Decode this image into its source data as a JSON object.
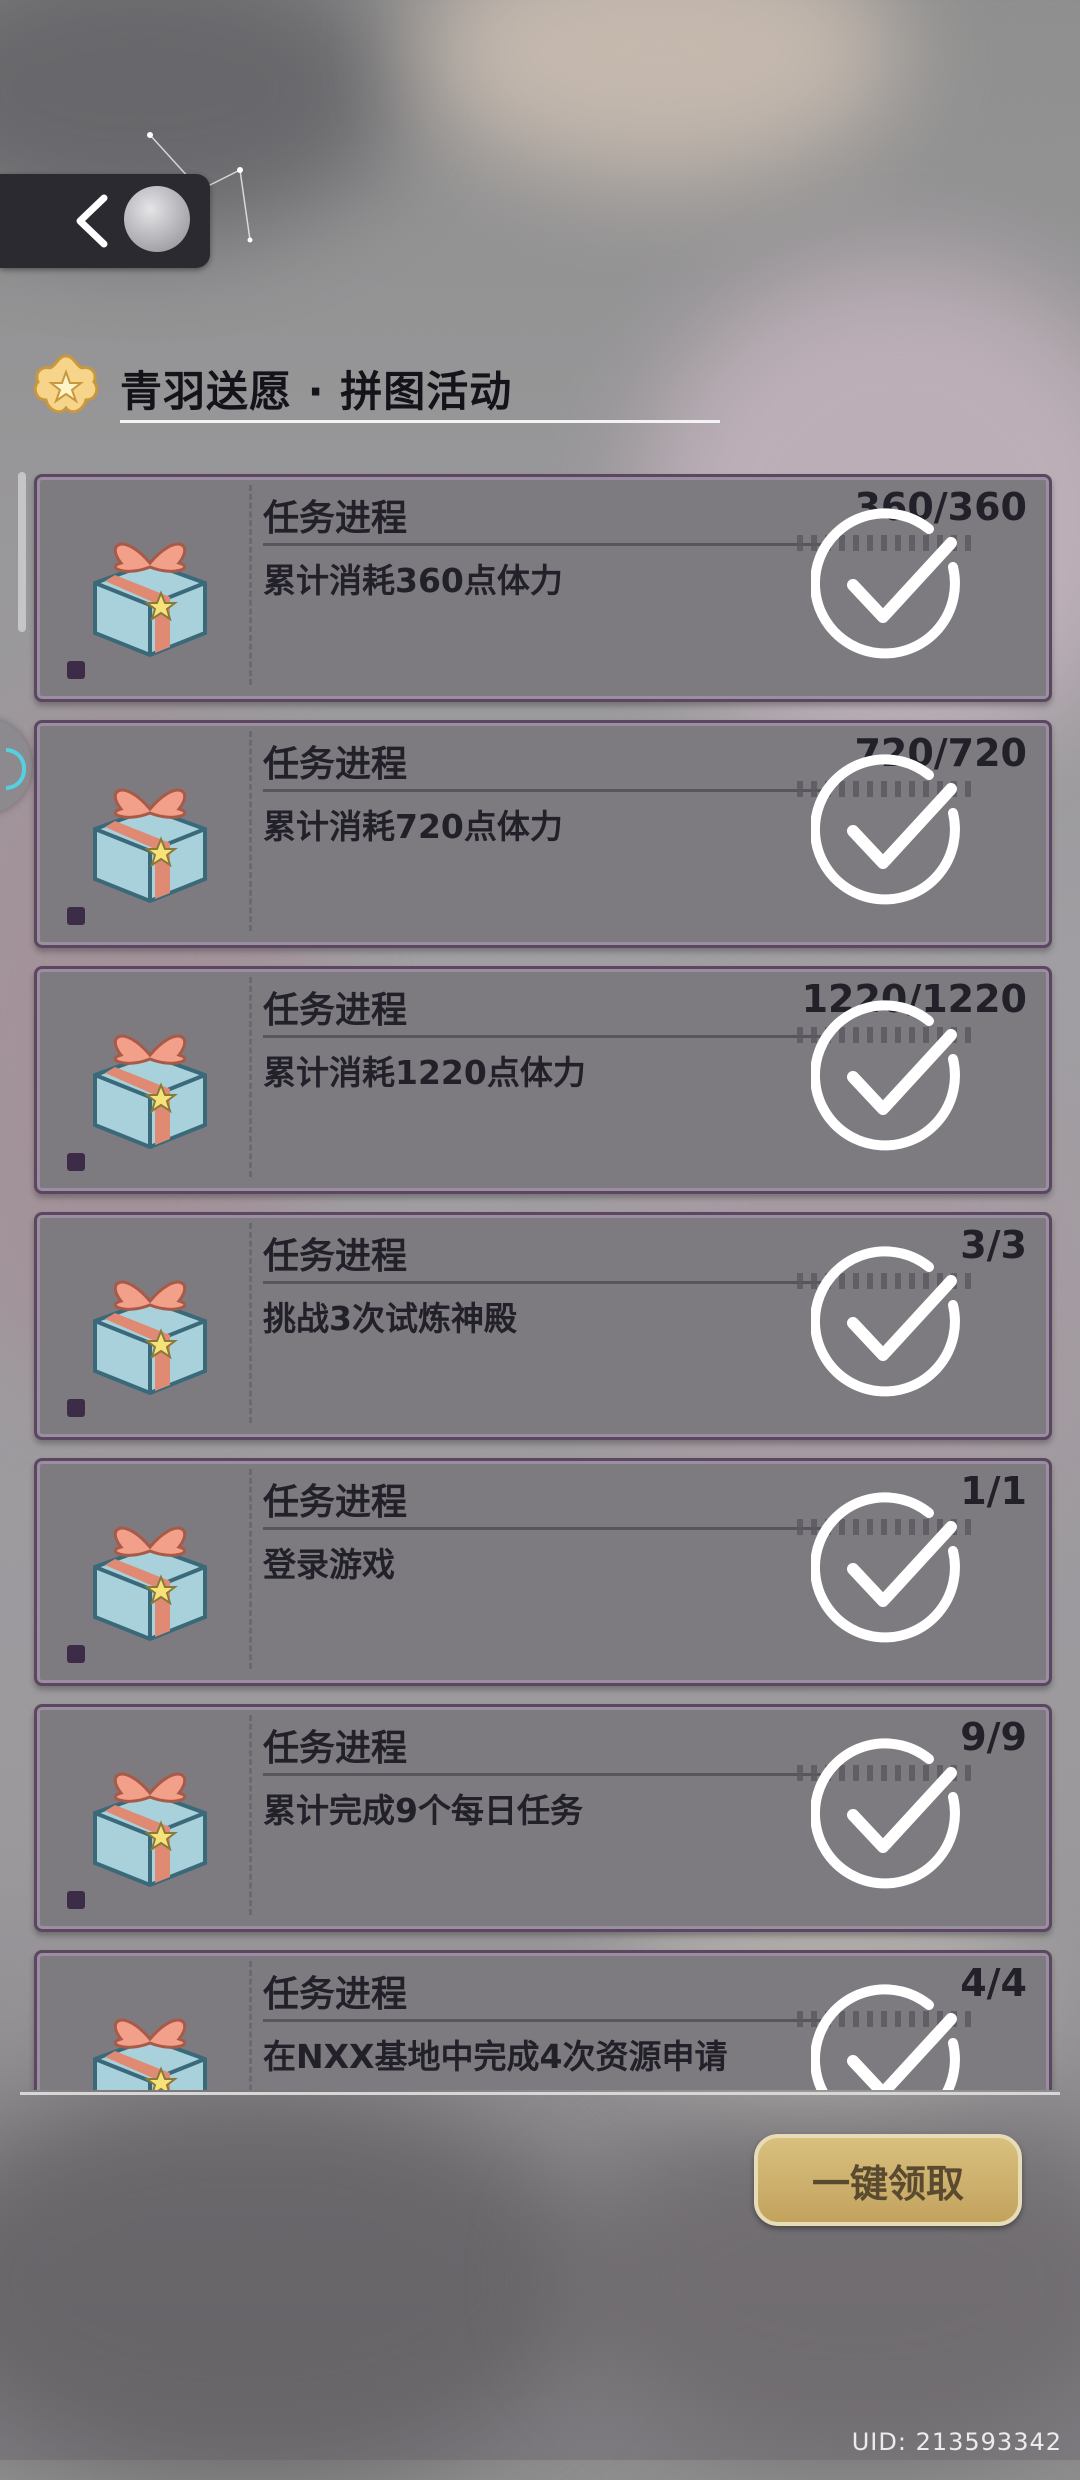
{
  "header": {
    "back_icon": "chevron-left-icon",
    "title": "青羽送愿 · 拼图活动",
    "title_icon": "star-flower-icon"
  },
  "tasks": [
    {
      "label": "任务进程",
      "desc": "累计消耗360点体力",
      "progress": "360/360",
      "status": "completed"
    },
    {
      "label": "任务进程",
      "desc": "累计消耗720点体力",
      "progress": "720/720",
      "status": "completed"
    },
    {
      "label": "任务进程",
      "desc": "累计消耗1220点体力",
      "progress": "1220/1220",
      "status": "completed"
    },
    {
      "label": "任务进程",
      "desc": "挑战3次试炼神殿",
      "progress": "3/3",
      "status": "completed"
    },
    {
      "label": "任务进程",
      "desc": "登录游戏",
      "progress": "1/1",
      "status": "completed"
    },
    {
      "label": "任务进程",
      "desc": "累计完成9个每日任务",
      "progress": "9/9",
      "status": "completed"
    },
    {
      "label": "任务进程",
      "desc": "在NXX基地中完成4次资源申请",
      "progress": "4/4",
      "status": "completed"
    }
  ],
  "footer": {
    "claim_all_label": "一键领取",
    "uid": "UID: 213593342"
  },
  "colors": {
    "card_bg": "#7e7b80",
    "card_border": "#5b4860",
    "button": "#c9ac66"
  }
}
